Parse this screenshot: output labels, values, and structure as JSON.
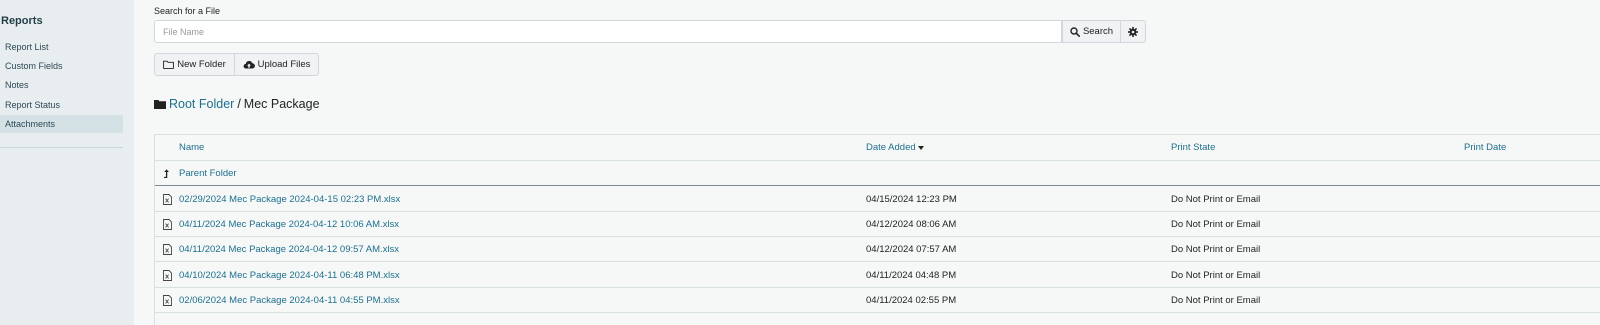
{
  "sidebar": {
    "title": "Reports",
    "items": [
      {
        "label": "Report List"
      },
      {
        "label": "Custom Fields"
      },
      {
        "label": "Notes"
      },
      {
        "label": "Report Status"
      },
      {
        "label": "Attachments"
      }
    ],
    "active_item": "Attachments"
  },
  "search": {
    "label": "Search for a File",
    "placeholder": "File Name",
    "value": "",
    "button_label": "Search",
    "search_icon": "search-icon",
    "settings_icon": "gear-icon"
  },
  "actions": {
    "new_folder_label": "New Folder",
    "new_folder_icon": "folder-outline-icon",
    "upload_label": "Upload Files",
    "upload_icon": "cloud-upload-icon"
  },
  "breadcrumb": {
    "icon": "folder-icon",
    "root": "Root Folder",
    "separator": "/",
    "current": "Mec Package"
  },
  "table": {
    "columns": {
      "name": "Name",
      "date_added": "Date Added",
      "print_state": "Print State",
      "print_date": "Print Date"
    },
    "sort": {
      "column": "Date Added",
      "direction": "descending"
    },
    "parent_folder": {
      "label": "Parent Folder",
      "icon": "level-up-icon"
    },
    "rows": [
      {
        "name": "02/29/2024 Mec Package 2024-04-15 02:23 PM.xlsx",
        "date_added": "04/15/2024 12:23 PM",
        "print_state": "Do Not Print or Email",
        "print_date": ""
      },
      {
        "name": "04/11/2024 Mec Package 2024-04-12 10:06 AM.xlsx",
        "date_added": "04/12/2024 08:06 AM",
        "print_state": "Do Not Print or Email",
        "print_date": ""
      },
      {
        "name": "04/11/2024 Mec Package 2024-04-12 09:57 AM.xlsx",
        "date_added": "04/12/2024 07:57 AM",
        "print_state": "Do Not Print or Email",
        "print_date": ""
      },
      {
        "name": "04/10/2024 Mec Package 2024-04-11 06:48 PM.xlsx",
        "date_added": "04/11/2024 04:48 PM",
        "print_state": "Do Not Print or Email",
        "print_date": ""
      },
      {
        "name": "02/06/2024 Mec Package 2024-04-11 04:55 PM.xlsx",
        "date_added": "04/11/2024 02:55 PM",
        "print_state": "Do Not Print or Email",
        "print_date": ""
      }
    ]
  },
  "colors": {
    "link": "#1d6f8c",
    "sidebar_bg": "#e8eef0",
    "page_bg": "#f6f8f8"
  }
}
